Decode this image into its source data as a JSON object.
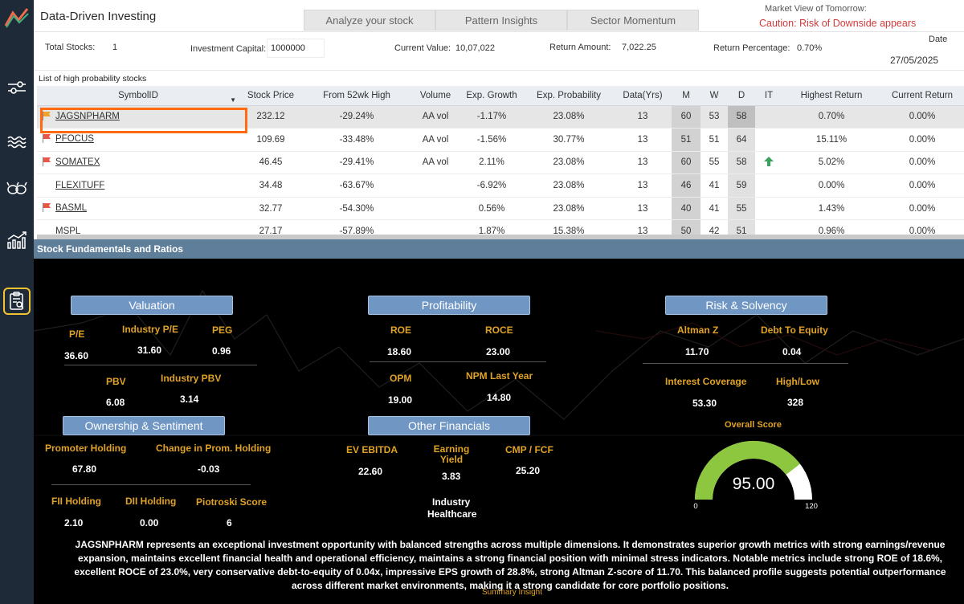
{
  "header": {
    "title": "Data-Driven Investing",
    "tabs": [
      "Analyze your stock",
      "Pattern Insights",
      "Sector Momentum"
    ],
    "market_view_label": "Market View of Tomorrow:",
    "market_view_value": "Caution: Risk of Downside appears"
  },
  "summary": {
    "total_stocks_label": "Total Stocks:",
    "total_stocks_value": "1",
    "capital_label": "Investment Capital:",
    "capital_value": "1000000",
    "current_value_label": "Current Value:",
    "current_value_value": "10,07,022",
    "return_amount_label": "Return Amount:",
    "return_amount_value": "7,022.25",
    "return_pct_label": "Return Percentage:",
    "return_pct_value": "0.70%",
    "date_label": "Date",
    "date_value": "27/05/2025"
  },
  "table": {
    "title": "List of high probability stocks",
    "columns": [
      "SymbolID",
      "Stock Price",
      "From 52wk High",
      "Volume",
      "Exp. Growth",
      "Exp. Probability",
      "Data(Yrs)",
      "M",
      "W",
      "D",
      "IT",
      "Highest Return",
      "Current Return"
    ],
    "rows": [
      {
        "flag": "orange",
        "symbol": "JAGSNPHARM",
        "price": "232.12",
        "from52": "-29.24%",
        "volume": "AA vol",
        "growth": "-1.17%",
        "prob": "23.08%",
        "yrs": "13",
        "m": "60",
        "w": "53",
        "d": "58",
        "it": "",
        "highest": "0.70%",
        "current": "0.00%"
      },
      {
        "flag": "red",
        "symbol": "PFOCUS",
        "price": "109.69",
        "from52": "-33.48%",
        "volume": "AA vol",
        "growth": "-1.56%",
        "prob": "30.77%",
        "yrs": "13",
        "m": "51",
        "w": "51",
        "d": "64",
        "it": "",
        "highest": "15.11%",
        "current": "0.00%"
      },
      {
        "flag": "red",
        "symbol": "SOMATEX",
        "price": "46.45",
        "from52": "-29.41%",
        "volume": "AA vol",
        "growth": "2.11%",
        "prob": "23.08%",
        "yrs": "13",
        "m": "60",
        "w": "55",
        "d": "58",
        "it": "up-arrow",
        "highest": "5.02%",
        "current": "0.00%"
      },
      {
        "flag": "",
        "symbol": "FLEXITUFF",
        "price": "34.48",
        "from52": "-63.67%",
        "volume": "",
        "growth": "-6.92%",
        "prob": "23.08%",
        "yrs": "13",
        "m": "46",
        "w": "41",
        "d": "59",
        "it": "",
        "highest": "0.00%",
        "current": "0.00%"
      },
      {
        "flag": "red",
        "symbol": "BASML",
        "price": "32.77",
        "from52": "-54.30%",
        "volume": "",
        "growth": "0.56%",
        "prob": "23.08%",
        "yrs": "13",
        "m": "40",
        "w": "41",
        "d": "55",
        "it": "",
        "highest": "1.43%",
        "current": "0.00%"
      },
      {
        "flag": "",
        "symbol": "MSPL",
        "price": "27.17",
        "from52": "-57.89%",
        "volume": "",
        "growth": "1.87%",
        "prob": "15.38%",
        "yrs": "13",
        "m": "50",
        "w": "42",
        "d": "51",
        "it": "",
        "highest": "0.96%",
        "current": "0.00%"
      }
    ]
  },
  "fundamentals": {
    "bar_title": "Stock Fundamentals and Ratios",
    "valuation": {
      "title": "Valuation",
      "pe_label": "P/E",
      "pe": "36.60",
      "ind_pe_label": "Industry P/E",
      "ind_pe": "31.60",
      "peg_label": "PEG",
      "peg": "0.96",
      "pbv_label": "PBV",
      "pbv": "6.08",
      "ind_pbv_label": "Industry PBV",
      "ind_pbv": "3.14"
    },
    "profitability": {
      "title": "Profitability",
      "roe_label": "ROE",
      "roe": "18.60",
      "roce_label": "ROCE",
      "roce": "23.00",
      "opm_label": "OPM",
      "opm": "19.00",
      "npm_label": "NPM Last Year",
      "npm": "14.80"
    },
    "risk": {
      "title": "Risk & Solvency",
      "altman_label": "Altman Z",
      "altman": "11.70",
      "de_label": "Debt To Equity",
      "de": "0.04",
      "ic_label": "Interest Coverage",
      "ic": "53.30",
      "hl_label": "High/Low",
      "hl": "328"
    },
    "ownership": {
      "title": "Ownership & Sentiment",
      "promoter_label": "Promoter Holding",
      "promoter": "67.80",
      "change_label": "Change in Prom. Holding",
      "change": "-0.03",
      "fii_label": "FII Holding",
      "fii": "2.10",
      "dii_label": "DII Holding",
      "dii": "0.00",
      "piotroski_label": "Piotroski Score",
      "piotroski": "6"
    },
    "other": {
      "title": "Other Financials",
      "ev_label": "EV EBITDA",
      "ev": "22.60",
      "ey_label": "Earning Yield",
      "ey": "3.83",
      "cmp_label": "CMP / FCF",
      "cmp": "25.20",
      "industry_label": "Industry",
      "industry": "Healthcare"
    },
    "score": {
      "label": "Overall Score",
      "value": "95.00",
      "min": "0",
      "max": "120",
      "fraction": 0.7917,
      "fill_color": "#8dc63f",
      "track_color": "#ffffff"
    },
    "narrative": "JAGSNPHARM represents an exceptional investment opportunity with balanced strengths across multiple dimensions. It demonstrates superior growth metrics with strong earnings/revenue expansion, maintains excellent financial health and operational efficiency, maintains a strong financial position with minimal stress indicators. Notable metrics include strong ROE of 18.6%, excellent ROCE of 23.0%, very conservative debt-to-equity of 0.04x, impressive EPS growth of 28.8%, strong Altman Z-score of 11.70. This balanced profile suggests potential outperformance across different market environments, making it a strong candidate for core portfolio positions.",
    "insight_label": "Summary Insight"
  },
  "colors": {
    "accent_orange": "#ff6a13",
    "caution_red": "#d23a3a",
    "label_gold": "#e0a224",
    "category_blue": "#7096c4",
    "sidebar": "#1f2a38",
    "arrow_green": "#3aa35a"
  }
}
